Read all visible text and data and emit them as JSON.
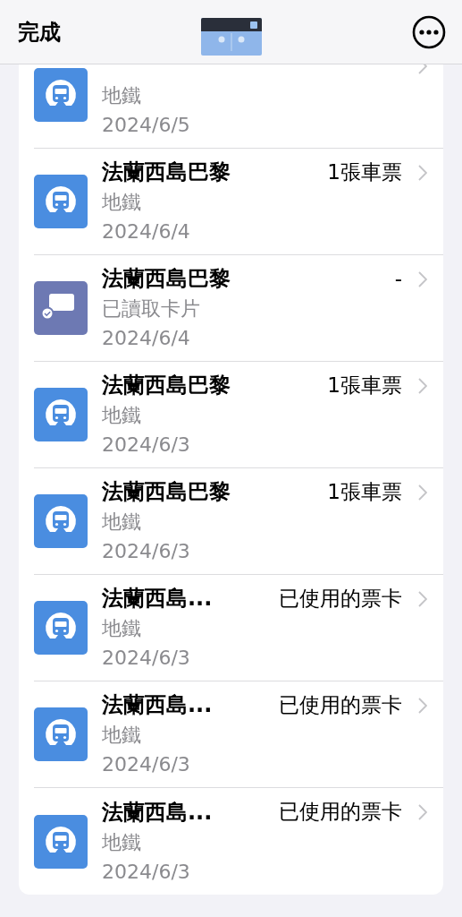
{
  "header": {
    "done_label": "完成"
  },
  "transactions": [
    {
      "kind": "metro",
      "subtitle": "地鐵",
      "date": "2024/6/5"
    },
    {
      "kind": "metro",
      "title": "法蘭西島巴黎",
      "subtitle": "地鐵",
      "date": "2024/6/4",
      "amount": "1張車票"
    },
    {
      "kind": "card_read",
      "title": "法蘭西島巴黎",
      "subtitle": "已讀取卡片",
      "date": "2024/6/4",
      "amount": "-"
    },
    {
      "kind": "metro",
      "title": "法蘭西島巴黎",
      "subtitle": "地鐵",
      "date": "2024/6/3",
      "amount": "1張車票"
    },
    {
      "kind": "metro",
      "title": "法蘭西島巴黎",
      "subtitle": "地鐵",
      "date": "2024/6/3",
      "amount": "1張車票"
    },
    {
      "kind": "metro",
      "title": "法蘭西島...",
      "subtitle": "地鐵",
      "date": "2024/6/3",
      "amount": "已使用的票卡"
    },
    {
      "kind": "metro",
      "title": "法蘭西島...",
      "subtitle": "地鐵",
      "date": "2024/6/3",
      "amount": "已使用的票卡"
    },
    {
      "kind": "metro",
      "title": "法蘭西島...",
      "subtitle": "地鐵",
      "date": "2024/6/3",
      "amount": "已使用的票卡"
    }
  ]
}
